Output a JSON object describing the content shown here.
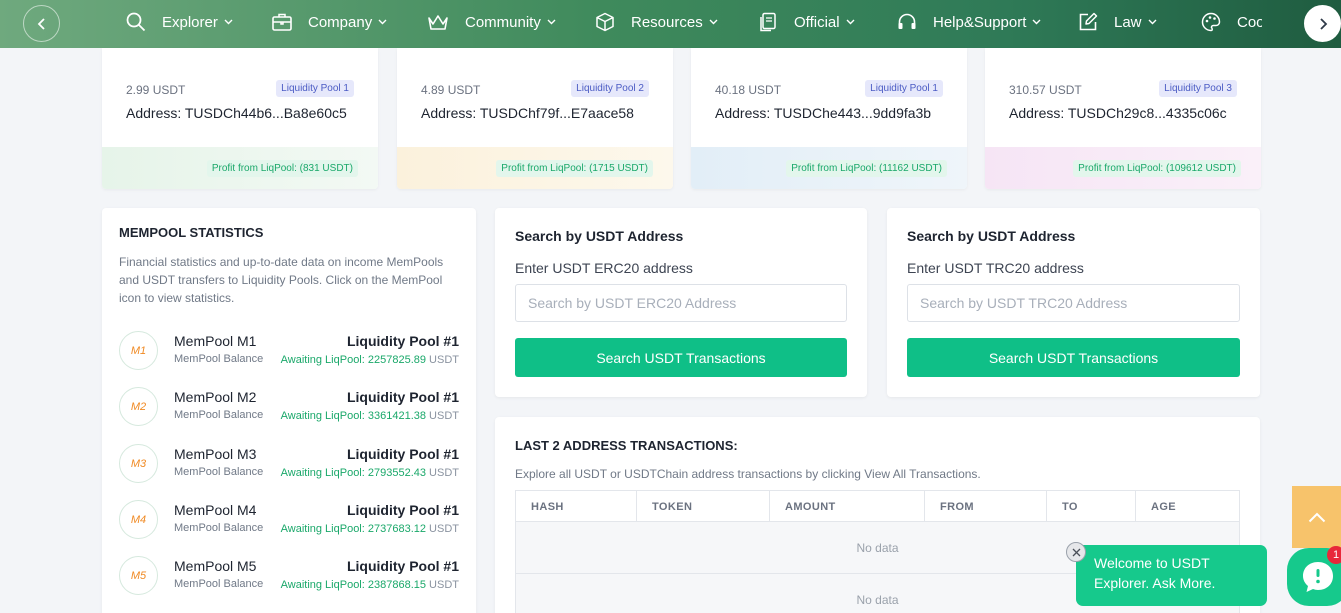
{
  "nav": {
    "items": [
      {
        "label": "Explorer",
        "icon": "search-icon"
      },
      {
        "label": "Company",
        "icon": "briefcase-icon"
      },
      {
        "label": "Community",
        "icon": "crown-icon"
      },
      {
        "label": "Resources",
        "icon": "box-icon"
      },
      {
        "label": "Official",
        "icon": "documents-icon"
      },
      {
        "label": "Help&Support",
        "icon": "headphones-icon"
      },
      {
        "label": "Law",
        "icon": "edit-icon"
      },
      {
        "label": "Coo",
        "icon": "palette-icon"
      }
    ]
  },
  "pools": [
    {
      "amount": "2.99 USDT",
      "tag": "Liquidity Pool 1",
      "address": "Address: TUSDCh44b6...Ba8e60c5",
      "profit": "Profit from LiqPool: (831 USDT)",
      "tint": "#e9f7ec"
    },
    {
      "amount": "4.89 USDT",
      "tag": "Liquidity Pool 2",
      "address": "Address: TUSDChf79f...E7aace58",
      "profit": "Profit from LiqPool: (1715 USDT)",
      "tint": "#fbf4e2"
    },
    {
      "amount": "40.18 USDT",
      "tag": "Liquidity Pool 1",
      "address": "Address: TUSDChe443...9dd9fa3b",
      "profit": "Profit from LiqPool: (11162 USDT)",
      "tint": "#e6f1f8"
    },
    {
      "amount": "310.57 USDT",
      "tag": "Liquidity Pool 3",
      "address": "Address: TUSDCh29c8...4335c06c",
      "profit": "Profit from LiqPool: (109612 USDT)",
      "tint": "#f8e8f7"
    }
  ],
  "mempool": {
    "title": "MEMPOOL STATISTICS",
    "description": "Financial statistics and up-to-date data on income MemPools and USDT transfers to Liquidity Pools. Click on the MemPool icon to view statistics.",
    "rows": [
      {
        "icon": "M1",
        "name": "MemPool M1",
        "sub": "MemPool Balance",
        "pool": "Liquidity Pool #1",
        "await": "Awaiting LiqPool: 2257825.89",
        "unit": "USDT"
      },
      {
        "icon": "M2",
        "name": "MemPool M2",
        "sub": "MemPool Balance",
        "pool": "Liquidity Pool #1",
        "await": "Awaiting LiqPool: 3361421.38",
        "unit": "USDT"
      },
      {
        "icon": "M3",
        "name": "MemPool M3",
        "sub": "MemPool Balance",
        "pool": "Liquidity Pool #1",
        "await": "Awaiting LiqPool: 2793552.43",
        "unit": "USDT"
      },
      {
        "icon": "M4",
        "name": "MemPool M4",
        "sub": "MemPool Balance",
        "pool": "Liquidity Pool #1",
        "await": "Awaiting LiqPool: 2737683.12",
        "unit": "USDT"
      },
      {
        "icon": "M5",
        "name": "MemPool M5",
        "sub": "MemPool Balance",
        "pool": "Liquidity Pool #1",
        "await": "Awaiting LiqPool: 2387868.15",
        "unit": "USDT"
      }
    ]
  },
  "search_erc": {
    "title": "Search by USDT Address",
    "label": "Enter USDT ERC20 address",
    "placeholder": "Search by USDT ERC20 Address",
    "value": "",
    "button": "Search USDT Transactions"
  },
  "search_trc": {
    "title": "Search by USDT Address",
    "label": "Enter USDT TRC20 address",
    "placeholder": "Search by USDT TRC20 Address",
    "value": "",
    "button": "Search USDT Transactions"
  },
  "transactions": {
    "title": "LAST 2 ADDRESS TRANSACTIONS:",
    "description": "Explore all USDT or USDTChain address transactions by clicking View All Transactions.",
    "columns": [
      "HASH",
      "TOKEN",
      "AMOUNT",
      "FROM",
      "TO",
      "AGE"
    ],
    "rows": [
      "No data",
      "No data"
    ]
  },
  "chat": {
    "message": "Welcome to USDT Explorer. Ask More.",
    "badge": "1"
  },
  "colors": {
    "accent": "#0fbf87",
    "nav": "#3f8a5c",
    "orange": "#f08a24",
    "scroll_top": "#f7c36b"
  }
}
